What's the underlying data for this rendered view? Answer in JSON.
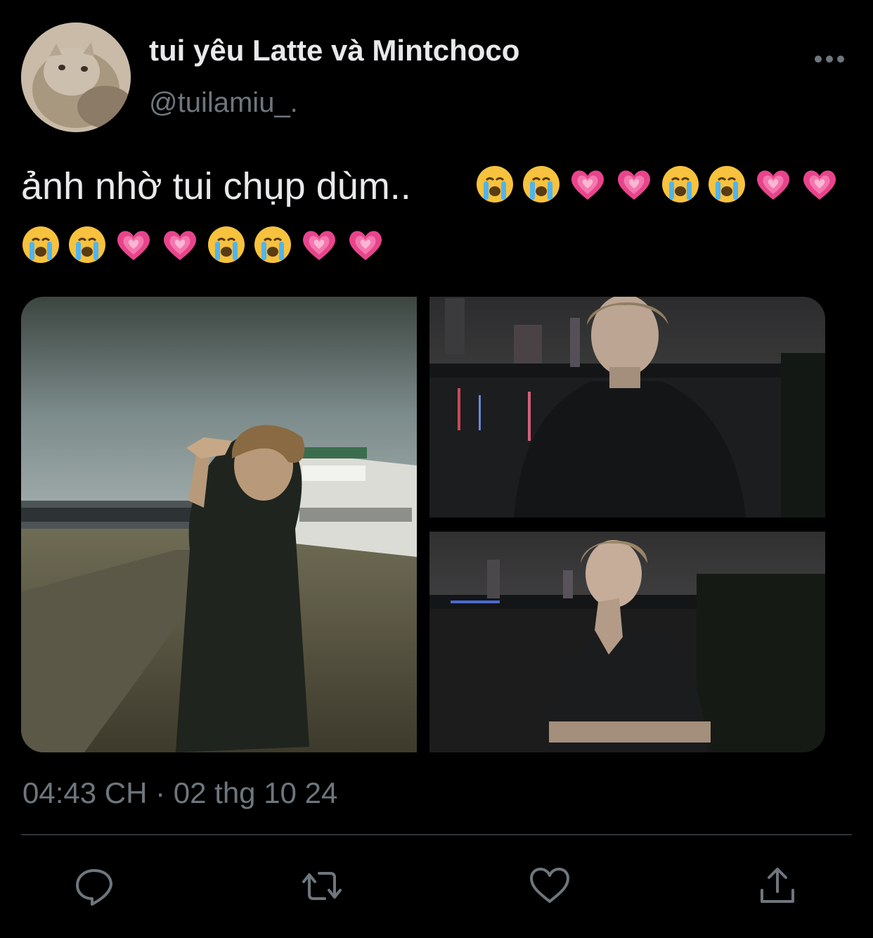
{
  "tweet": {
    "display_name": "tui yêu Latte và Mintchoco",
    "handle": "@tuilamiu_.",
    "text": "ảnh nhờ tui chụp dùm..",
    "emoji_line_1": [
      "loudly-crying-face",
      "loudly-crying-face",
      "growing-heart",
      "growing-heart",
      "loudly-crying-face",
      "loudly-crying-face",
      "growing-heart",
      "growing-heart"
    ],
    "emoji_line_2": [
      "loudly-crying-face",
      "loudly-crying-face",
      "growing-heart",
      "growing-heart",
      "loudly-crying-face",
      "loudly-crying-face",
      "growing-heart",
      "growing-heart"
    ],
    "timestamp": "04:43 CH · 02 thg 10 24"
  },
  "media": {
    "count": 3,
    "photos": [
      "photo-riverside-peace-sign",
      "photo-river-night-portrait",
      "photo-river-night-hand-on-chin"
    ]
  },
  "actions": {
    "icons": [
      "reply-icon",
      "retweet-icon",
      "like-icon",
      "share-icon"
    ]
  },
  "colors": {
    "background": "#000000",
    "primary_text": "#e7e9ea",
    "secondary_text": "#6e767d",
    "divider": "#2f3336"
  }
}
